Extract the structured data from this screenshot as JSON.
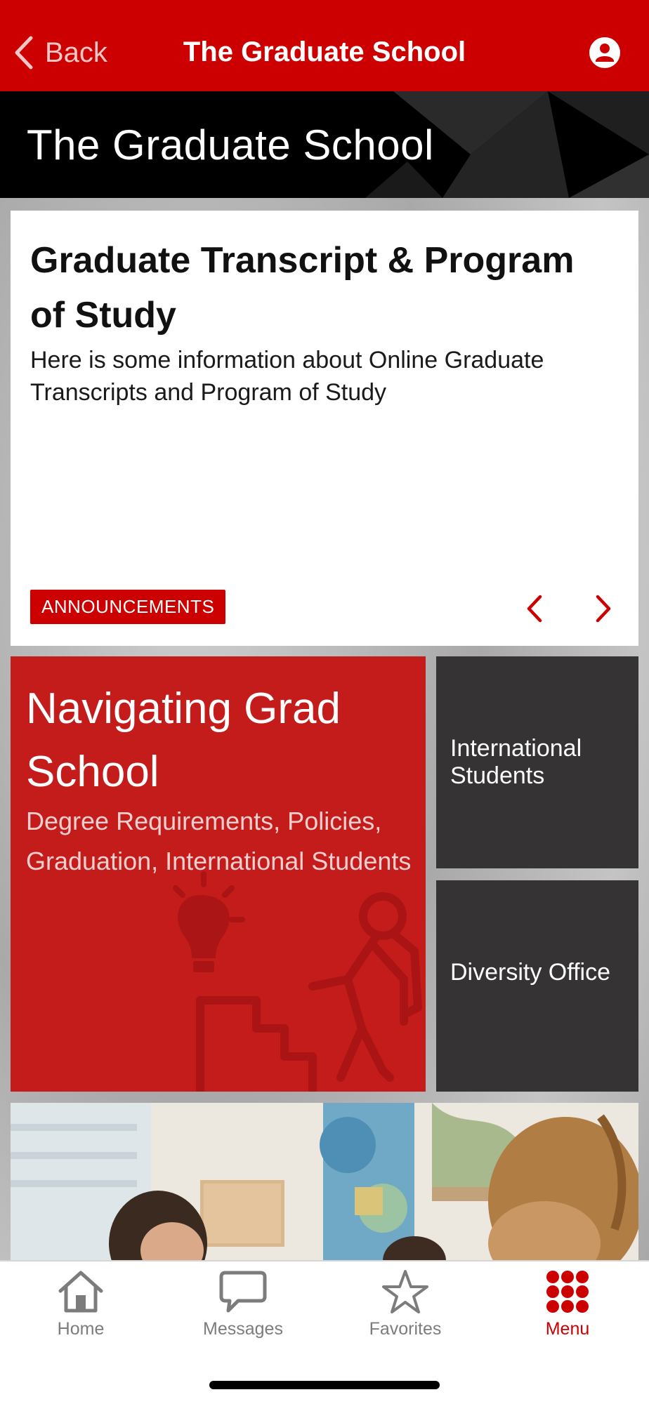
{
  "colors": {
    "brand_red": "#cc0000",
    "tile_red": "#c41b1b",
    "tile_dark": "#353334",
    "tab_inactive": "#7c7c7c"
  },
  "topbar": {
    "back_label": "Back",
    "title": "The Graduate School",
    "back_icon": "chevron-left-icon",
    "account_icon": "user-circle-icon"
  },
  "section": {
    "title": "The Graduate School"
  },
  "announcement": {
    "title": "Graduate Transcript & Program of Study",
    "body": "Here is some information about Online Graduate Transcripts and Program of Study",
    "tag": "ANNOUNCEMENTS",
    "prev_icon": "chevron-left-icon",
    "next_icon": "chevron-right-icon"
  },
  "tiles": {
    "navigating": {
      "title": "Navigating Grad School",
      "description": "Degree Requirements, Policies, Graduation, International Students"
    },
    "international": {
      "label": "International Students"
    },
    "diversity": {
      "label": "Diversity Office"
    }
  },
  "tabbar": {
    "items": [
      {
        "label": "Home",
        "icon": "house-icon",
        "active": false
      },
      {
        "label": "Messages",
        "icon": "speech-bubble-icon",
        "active": false
      },
      {
        "label": "Favorites",
        "icon": "star-icon",
        "active": false
      },
      {
        "label": "Menu",
        "icon": "grid-dots-icon",
        "active": true
      }
    ]
  }
}
